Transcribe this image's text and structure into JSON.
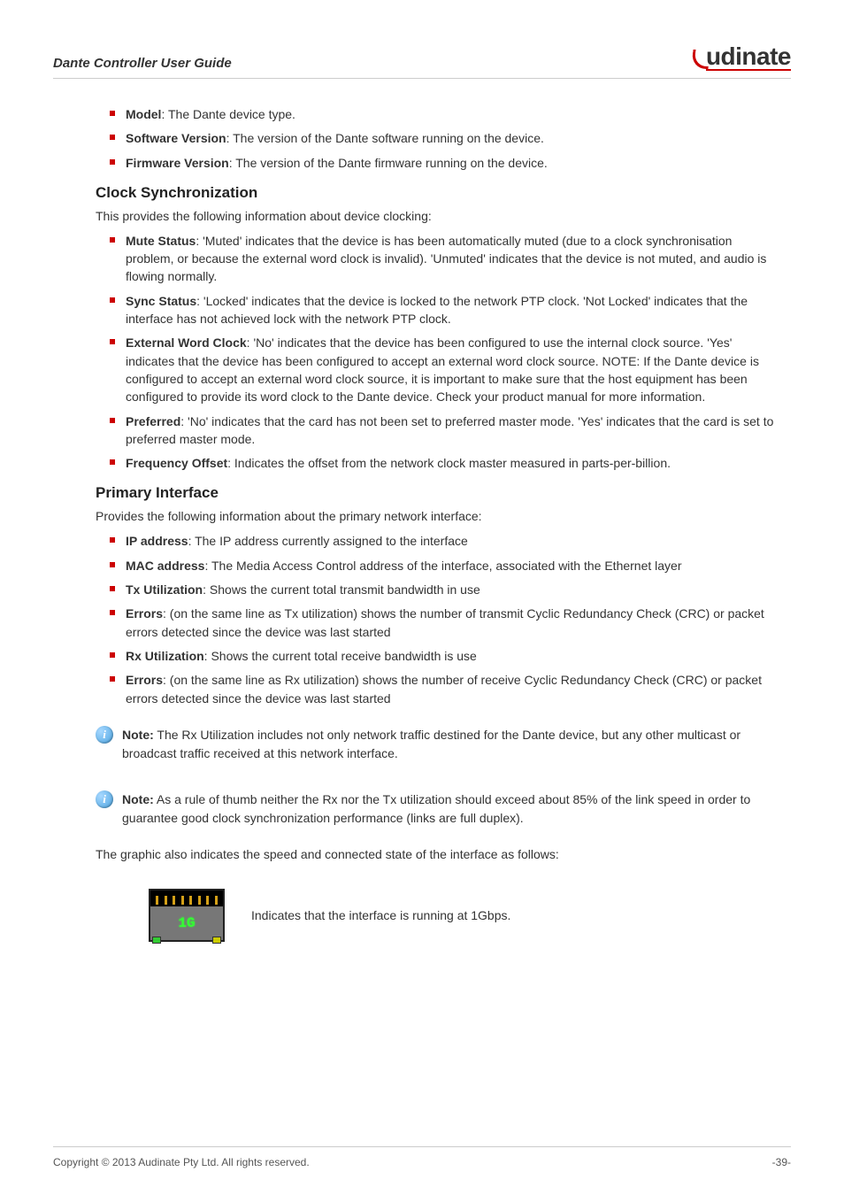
{
  "header": {
    "doc_title": "Dante Controller User Guide",
    "brand_name": "udinate"
  },
  "top_list": [
    {
      "term": "Model",
      "desc": ": The Dante device type."
    },
    {
      "term": "Software Version",
      "desc": ": The version of the Dante software running on the device."
    },
    {
      "term": "Firmware Version",
      "desc": ": The version of the Dante firmware running on the device."
    }
  ],
  "clock_sync": {
    "heading": "Clock Synchronization",
    "intro": "This provides the following information about device clocking:",
    "items": [
      {
        "term": "Mute Status",
        "desc": ": 'Muted' indicates that the device is has been automatically muted (due to a clock synchronisation problem, or because the external word clock is invalid). 'Unmuted' indicates that the device is not muted, and audio is flowing normally."
      },
      {
        "term": "Sync Status",
        "desc": ": 'Locked' indicates that the device is locked to the network PTP clock. 'Not Locked' indicates that the interface has not achieved lock with the network PTP clock."
      },
      {
        "term": "External Word Clock",
        "desc": ": 'No' indicates that the device has been configured to use the internal clock source. 'Yes' indicates that the device has been configured to accept an external word clock source. NOTE: If the Dante device is configured to accept an external word clock source, it is important to make sure that the host equipment has been configured to provide its word clock to the Dante device. Check your product manual for more information."
      },
      {
        "term": "Preferred",
        "desc": ": 'No' indicates that the card has not been set to preferred master mode. 'Yes' indicates that the card is set to preferred master mode."
      },
      {
        "term": "Frequency Offset",
        "desc": ": Indicates the offset from the network clock master measured in parts-per-billion."
      }
    ]
  },
  "primary_iface": {
    "heading": "Primary Interface",
    "intro": "Provides the following information about the primary network interface:",
    "items": [
      {
        "term": "IP address",
        "desc": ": The IP address currently assigned to the interface"
      },
      {
        "term": "MAC address",
        "desc": ": The Media Access Control address of the interface, associated with the Ethernet layer"
      },
      {
        "term": "Tx Utilization",
        "desc": ": Shows the current total transmit bandwidth in use"
      },
      {
        "term": "Errors",
        "desc": ": (on the same line as Tx utilization) shows the number of transmit Cyclic Redundancy Check (CRC) or packet errors detected since the device was last started"
      },
      {
        "term": "Rx Utilization",
        "desc": ": Shows the current total receive bandwidth is use"
      },
      {
        "term": "Errors",
        "desc": ": (on the same line as Rx utilization) shows the number of receive Cyclic Redundancy Check (CRC) or packet errors detected since the device was last started"
      }
    ]
  },
  "notes": {
    "label": "Note:",
    "note1": " The Rx Utilization includes not only network traffic destined for the Dante device, but any other multicast or broadcast traffic received at this network interface.",
    "note2": " As a rule of thumb neither the Rx nor the Tx utilization should exceed about 85% of the link speed in order to guarantee good clock synchronization performance (links are full duplex)."
  },
  "graphic_intro": "The graphic also indicates the speed and connected state of the interface as follows:",
  "port": {
    "speed_label": "1G",
    "caption": "Indicates that the interface is running at 1Gbps."
  },
  "footer": {
    "copyright": "Copyright © 2013 Audinate Pty Ltd. All rights reserved.",
    "page": "-39-"
  }
}
